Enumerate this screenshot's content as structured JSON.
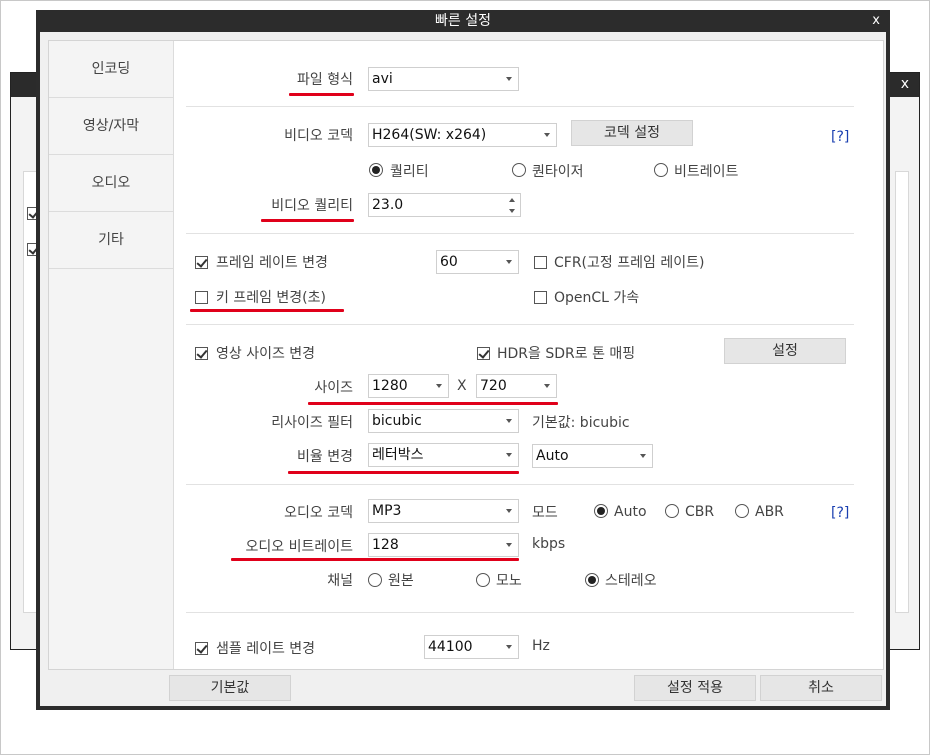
{
  "dialog": {
    "title": "빠른 설정",
    "close": "x"
  },
  "bg_window": {
    "close": "x"
  },
  "sidebar": {
    "items": [
      "인코딩",
      "영상/자막",
      "오디오",
      "기타"
    ]
  },
  "file_format": {
    "label": "파일 형식",
    "value": "avi"
  },
  "video_codec": {
    "label": "비디오 코덱",
    "value": "H264(SW: x264)",
    "settings_button": "코덱 설정",
    "help": "[?]"
  },
  "rate_mode": {
    "options": [
      "퀄리티",
      "퀀타이저",
      "비트레이트"
    ],
    "selected": "퀄리티"
  },
  "video_quality": {
    "label": "비디오 퀄리티",
    "value": "23.0"
  },
  "frame_rate": {
    "label": "프레임 레이트 변경",
    "checked": true,
    "value": "60",
    "cfr_label": "CFR(고정 프레임 레이트)"
  },
  "keyframe": {
    "label": "키 프레임 변경(초)",
    "checked": false,
    "opencl_label": "OpenCL 가속"
  },
  "resize": {
    "label": "영상 사이즈 변경",
    "checked": true,
    "hdr_label": "HDR을 SDR로 톤 매핑",
    "hdr_checked": true,
    "settings_button": "설정",
    "size_label": "사이즈",
    "width": "1280",
    "x_sep": "X",
    "height": "720",
    "filter_label": "리사이즈 필터",
    "filter_value": "bicubic",
    "filter_default": "기본값: bicubic",
    "aspect_label": "비율 변경",
    "aspect_value": "레터박스",
    "aspect_value2": "Auto"
  },
  "audio_codec": {
    "label": "오디오 코덱",
    "value": "MP3",
    "mode_label": "모드",
    "modes": [
      "Auto",
      "CBR",
      "ABR"
    ],
    "selected_mode": "Auto",
    "help": "[?]"
  },
  "audio_bitrate": {
    "label": "오디오 비트레이트",
    "value": "128",
    "unit": "kbps"
  },
  "channel": {
    "label": "채널",
    "options": [
      "원본",
      "모노",
      "스테레오"
    ],
    "selected": "스테레오"
  },
  "sample_rate": {
    "label": "샘플 레이트 변경",
    "checked": true,
    "value": "44100",
    "unit": "Hz"
  },
  "footer": {
    "default_button": "기본값",
    "apply_button": "설정 적용",
    "cancel_button": "취소"
  },
  "colors": {
    "highlight_underline": "#e0001a",
    "title_bar": "#2c2c2c",
    "help_link": "#1a3fb0"
  }
}
